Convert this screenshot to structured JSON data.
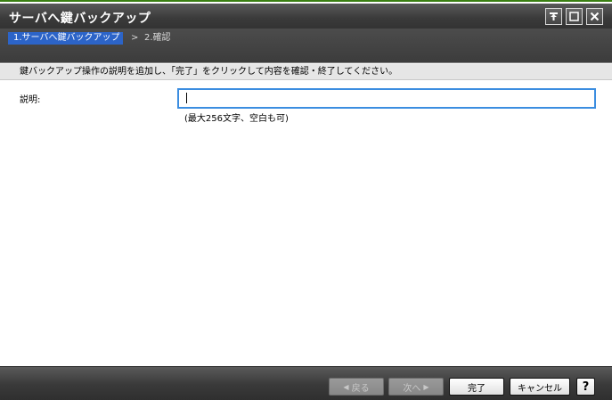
{
  "window": {
    "title": "サーバへ鍵バックアップ",
    "controls": [
      "pin-icon",
      "maximize-icon",
      "close-icon"
    ]
  },
  "wizard": {
    "steps": [
      {
        "label": "1.サーバへ鍵バックアップ",
        "active": true
      },
      {
        "label": "2.確認",
        "active": false
      }
    ],
    "separator": ">"
  },
  "instruction": "鍵バックアップ操作の説明を追加し、「完了」をクリックして内容を確認・終了してください。",
  "form": {
    "description_label": "説明:",
    "description_value": "",
    "description_hint": "(最大256文字、空白も可)"
  },
  "footer": {
    "back_label": "戻る",
    "next_label": "次へ",
    "finish_label": "完了",
    "cancel_label": "キャンセル",
    "help_label": "?"
  },
  "colors": {
    "accent": "#2c64c8",
    "input_focus": "#3b8de0",
    "title_border": "#3a7f12"
  }
}
